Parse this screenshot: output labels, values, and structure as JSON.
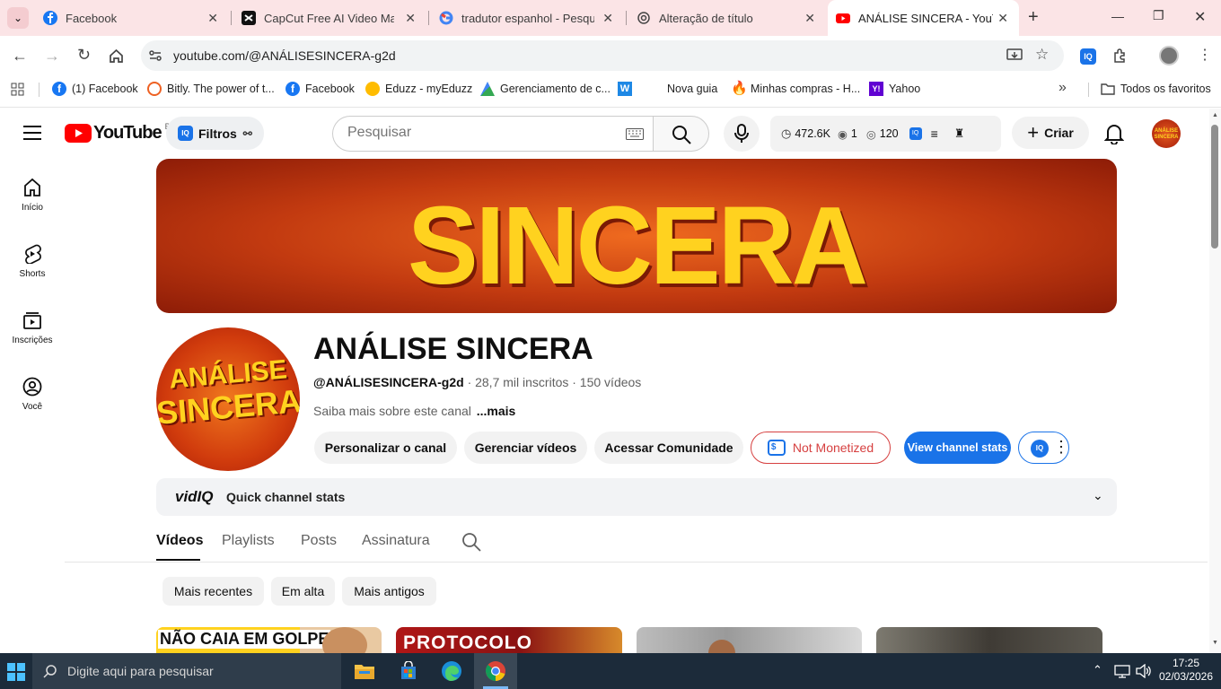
{
  "browser": {
    "tabs": [
      {
        "title": "Facebook",
        "active": false
      },
      {
        "title": "CapCut Free AI Video Maker",
        "active": false
      },
      {
        "title": "tradutor espanhol - Pesquisa",
        "active": false
      },
      {
        "title": "Alteração de título",
        "active": false
      },
      {
        "title": "ANÁLISE SINCERA - YouTube",
        "active": true
      }
    ],
    "url": "youtube.com/@ANÁLISESINCERA-g2d",
    "bookmarks": [
      "(1) Facebook",
      "Bitly. The power of t...",
      "Facebook",
      "Eduzz - myEduzz",
      "Gerenciamento de c...",
      "Nova guia",
      "Minhas compras - H...",
      "Yahoo"
    ],
    "all_bookmarks_label": "Todos os favoritos",
    "overflow_label": "»"
  },
  "yt": {
    "logo_text": "YouTube",
    "region": "BR",
    "filters_label": "Filtros",
    "search_placeholder": "Pesquisar",
    "stats": {
      "views": "472.6K",
      "eye": "1",
      "watch": "120"
    },
    "create_label": "Criar",
    "sidebar": [
      "Início",
      "Shorts",
      "Inscrições",
      "Você"
    ],
    "banner_text": "SINCERA",
    "avatar_line1": "ANÁLISE",
    "avatar_line2": "SINCERA",
    "channel": {
      "name": "ANÁLISE SINCERA",
      "handle": "@ANÁLISESINCERA-g2d",
      "meta": "· 28,7 mil inscritos · 150 vídeos",
      "about": "Saiba mais sobre este canal",
      "more": "...mais"
    },
    "actions": {
      "customize": "Personalizar o canal",
      "manage": "Gerenciar vídeos",
      "community": "Acessar Comunidade",
      "not_monetized": "Not Monetized",
      "stats": "View channel stats"
    },
    "vidiq": {
      "brand": "vidIQ",
      "label": "Quick channel stats"
    },
    "tabs": [
      "Vídeos",
      "Playlists",
      "Posts",
      "Assinatura"
    ],
    "chips": [
      "Mais recentes",
      "Em alta",
      "Mais antigos"
    ],
    "thumbs": [
      "NÃO CAIA EM GOLPE",
      "PROTOCOLO"
    ]
  },
  "taskbar": {
    "search_placeholder": "Digite aqui para pesquisar",
    "time": "17:25",
    "date": "02/03/2026"
  },
  "colors": {
    "yt_red": "#ff0000",
    "vidiq_blue": "#1a73e8",
    "tabstrip": "#fbe4e6",
    "banner_orange": "#d9461a",
    "banner_yellow": "#ffd21f"
  }
}
